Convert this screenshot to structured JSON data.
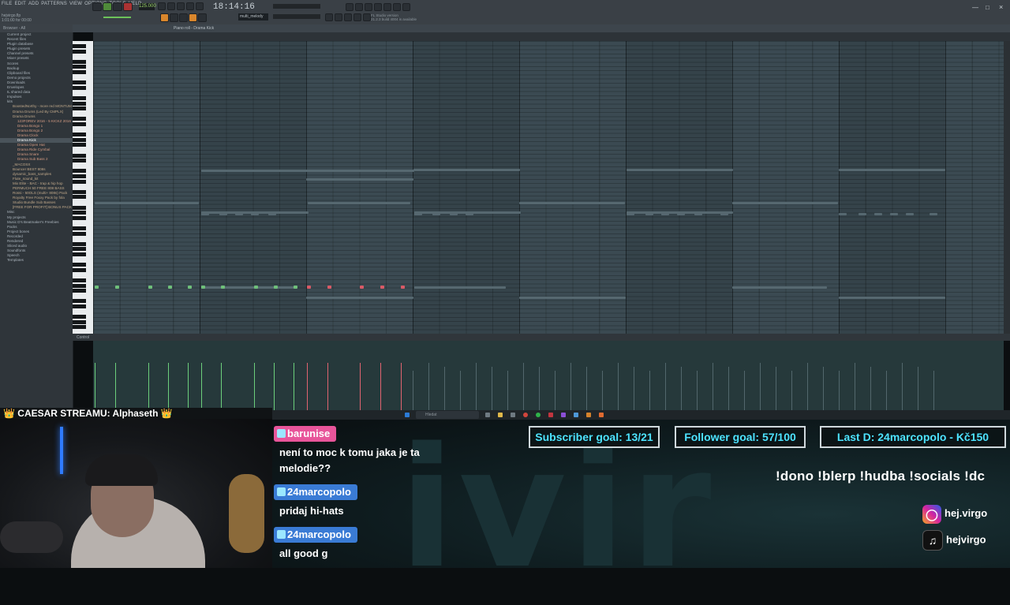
{
  "daw": {
    "menu": [
      "FILE",
      "EDIT",
      "ADD",
      "PATTERNS",
      "VIEW",
      "OPTIONS",
      "TOOLS",
      "HELP"
    ],
    "project_line1": "hejvirgo.flp",
    "project_line2": "1:01:00 for 00:00",
    "clock": "18:14:16",
    "tempo": "125.000",
    "pattern_name": "multi_melody",
    "hint_line1": "FL Studio version",
    "hint_line2": "21.2.3 build 4004 is available",
    "pianoroll_title": "Piano roll - Drama Kick",
    "browser_header": "Browser - All",
    "browser_items": [
      {
        "label": "Current project",
        "level": 0
      },
      {
        "label": "Recent files",
        "level": 0
      },
      {
        "label": "Plugin database",
        "level": 0
      },
      {
        "label": "Plugin presets",
        "level": 0
      },
      {
        "label": "Channel presets",
        "level": 0
      },
      {
        "label": "Mixer presets",
        "level": 0
      },
      {
        "label": "Scores",
        "level": 0
      },
      {
        "label": "Backup",
        "level": 0
      },
      {
        "label": "Clipboard files",
        "level": 0
      },
      {
        "label": "Demo projects",
        "level": 0
      },
      {
        "label": "Downloads",
        "level": 0
      },
      {
        "label": "Envelopes",
        "level": 0
      },
      {
        "label": "IL shared data",
        "level": 0
      },
      {
        "label": "Impulses",
        "level": 0
      },
      {
        "label": "kits",
        "level": 0
      },
      {
        "label": "BoostedNorthy - more red MONTUM",
        "level": 1
      },
      {
        "label": "Drama Drums (Led By CMPLX)",
        "level": 1
      },
      {
        "label": "Drama Drums",
        "level": 1
      },
      {
        "label": "123FOREV 2016 - 5 KICKZ 2016",
        "level": 2
      },
      {
        "label": "Drama Bongo 1",
        "level": 2
      },
      {
        "label": "Drama Bongo 2",
        "level": 2
      },
      {
        "label": "Drama Clock",
        "level": 2
      },
      {
        "label": "Drama Kick",
        "level": 2,
        "selected": true
      },
      {
        "label": "Drama Open Hat",
        "level": 2
      },
      {
        "label": "Drama Ride Cymbal",
        "level": 2
      },
      {
        "label": "Drama Snare",
        "level": 2
      },
      {
        "label": "Drama Sub Bass 2",
        "level": 2
      },
      {
        "label": "_MACOSX",
        "level": 1
      },
      {
        "label": "Bouncer BEST 808s",
        "level": 1
      },
      {
        "label": "dynamic_bass_samples",
        "level": 1
      },
      {
        "label": "Flute_sound_kit",
        "level": 1
      },
      {
        "label": "Mix Elite - BAC - trap & hip hop",
        "level": 1
      },
      {
        "label": "PERMUCH 50 FREE 808 BASS",
        "level": 1
      },
      {
        "label": "Rossi - 50OLS (multi+ 808s) Pack",
        "level": 1
      },
      {
        "label": "Royalty Free Foxxy Pack by fola",
        "level": 1
      },
      {
        "label": "Studio Bundle Sub Basses",
        "level": 1
      },
      {
        "label": "[FREE FOR PROFIT] BONUS PACK",
        "level": 1
      },
      {
        "label": "Misc",
        "level": 0
      },
      {
        "label": "My projects",
        "level": 0
      },
      {
        "label": "Music D's Beatmaker's Freebies",
        "level": 0
      },
      {
        "label": "Packs",
        "level": 0
      },
      {
        "label": "Project bones",
        "level": 0
      },
      {
        "label": "Recorded",
        "level": 0
      },
      {
        "label": "Rendered",
        "level": 0
      },
      {
        "label": "Sliced audio",
        "level": 0
      },
      {
        "label": "Soundfonts",
        "level": 0
      },
      {
        "label": "Speech",
        "level": 0
      },
      {
        "label": "Templates",
        "level": 0
      }
    ],
    "control_label": "Control",
    "taskbar_search": "Hledat"
  },
  "overlay": {
    "banner": "👑 CAESAR STREAMU: Alphaseth 👑",
    "goals": [
      {
        "label": "Subscriber goal: 13/21"
      },
      {
        "label": "Follower goal: 57/100"
      },
      {
        "label": "Last D: 24marcopolo - Kč150"
      }
    ],
    "commands": "!dono !blerp !hudba !socials !dc",
    "socials": [
      {
        "platform": "instagram-icon",
        "handle": "hej.virgo"
      },
      {
        "platform": "tiktok-icon",
        "handle": "hejvirgo"
      }
    ],
    "chat": [
      {
        "user": "barunise",
        "user_color": "#e8559a",
        "message_lines": [
          "není to moc k tomu jaka je ta",
          "melodie??"
        ]
      },
      {
        "user": "24marcopolo",
        "user_color": "#3a7bd5",
        "message_lines": [
          "pridaj hi-hats"
        ]
      },
      {
        "user": "24marcopolo",
        "user_color": "#3a7bd5",
        "message_lines": [
          "all good g"
        ]
      }
    ]
  }
}
